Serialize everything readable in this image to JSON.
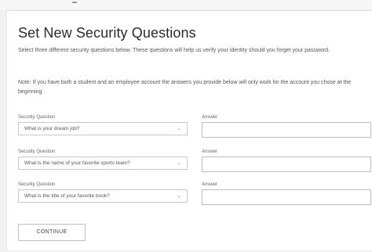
{
  "page": {
    "title": "Set New Security Questions",
    "intro": "Select three different security questions below. These questions will help us verify your identity should you forget your password.",
    "note": "Note: If you have both a student and an employee account the answers you provide below will only work for the account you chose at the beginning."
  },
  "form": {
    "question_label": "Security Question",
    "answer_label": "Answer",
    "rows": [
      {
        "question": "What is your dream job?",
        "answer": ""
      },
      {
        "question": "What is the name of your favorite sports team?",
        "answer": ""
      },
      {
        "question": "What is the title of your favorite book?",
        "answer": ""
      }
    ],
    "continue_label": "CONTINUE"
  }
}
